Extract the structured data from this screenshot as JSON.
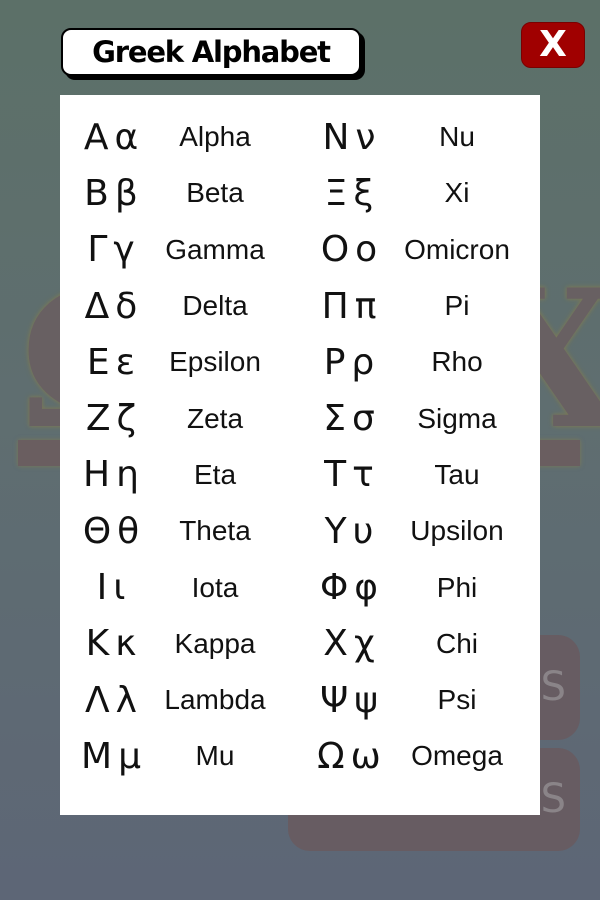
{
  "header": {
    "title": "Greek Alphabet",
    "close_label": "X"
  },
  "background": {
    "logo_left": "Ω",
    "logo_right": "X",
    "button_one_text": "S",
    "button_two_text": "PS"
  },
  "letters_left": [
    {
      "upper": "Α",
      "lower": "α",
      "name": "Alpha"
    },
    {
      "upper": "Β",
      "lower": "β",
      "name": "Beta"
    },
    {
      "upper": "Γ",
      "lower": "γ",
      "name": "Gamma"
    },
    {
      "upper": "Δ",
      "lower": "δ",
      "name": "Delta"
    },
    {
      "upper": "Ε",
      "lower": "ε",
      "name": "Epsilon"
    },
    {
      "upper": "Ζ",
      "lower": "ζ",
      "name": "Zeta"
    },
    {
      "upper": "Η",
      "lower": "η",
      "name": "Eta"
    },
    {
      "upper": "Θ",
      "lower": "θ",
      "name": "Theta"
    },
    {
      "upper": "Ι",
      "lower": "ι",
      "name": "Iota"
    },
    {
      "upper": "Κ",
      "lower": "κ",
      "name": "Kappa"
    },
    {
      "upper": "Λ",
      "lower": "λ",
      "name": "Lambda"
    },
    {
      "upper": "Μ",
      "lower": "μ",
      "name": "Mu"
    }
  ],
  "letters_right": [
    {
      "upper": "Ν",
      "lower": "ν",
      "name": "Nu"
    },
    {
      "upper": "Ξ",
      "lower": "ξ",
      "name": "Xi"
    },
    {
      "upper": "Ο",
      "lower": "ο",
      "name": "Omicron"
    },
    {
      "upper": "Π",
      "lower": "π",
      "name": "Pi"
    },
    {
      "upper": "Ρ",
      "lower": "ρ",
      "name": "Rho"
    },
    {
      "upper": "Σ",
      "lower": "σ",
      "name": "Sigma"
    },
    {
      "upper": "Τ",
      "lower": "τ",
      "name": "Tau"
    },
    {
      "upper": "Υ",
      "lower": "υ",
      "name": "Upsilon"
    },
    {
      "upper": "Φ",
      "lower": "φ",
      "name": "Phi"
    },
    {
      "upper": "Χ",
      "lower": "χ",
      "name": "Chi"
    },
    {
      "upper": "Ψ",
      "lower": "ψ",
      "name": "Psi"
    },
    {
      "upper": "Ω",
      "lower": "ω",
      "name": "Omega"
    }
  ],
  "colors": {
    "close_button": "#a00000",
    "panel": "#ffffff",
    "text": "#111111"
  }
}
